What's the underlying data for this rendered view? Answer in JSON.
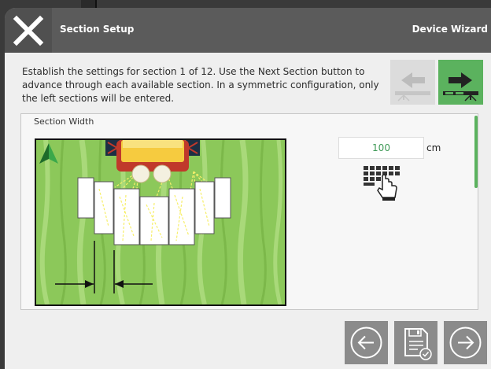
{
  "header": {
    "title": "Section Setup",
    "right_title": "Device Wizard",
    "close_icon": "close-icon"
  },
  "instructions": "Establish the settings for section 1 of 12. Use the Next Section button to advance through each available section. In a symmetric configuration, only the left sections will be entered.",
  "section_width": {
    "label": "Section Width",
    "value": "100",
    "unit": "cm"
  },
  "colors": {
    "accent_green": "#5bb25e",
    "value_text": "#3f9a57",
    "titlebar": "#5b5b5b",
    "field_grass": "#8cc85a"
  },
  "icons": {
    "prev_section": "previous-section-icon",
    "next_section": "next-section-icon",
    "keyboard": "keyboard-icon",
    "back": "back-arrow-icon",
    "save": "save-icon",
    "forward": "forward-arrow-icon"
  }
}
